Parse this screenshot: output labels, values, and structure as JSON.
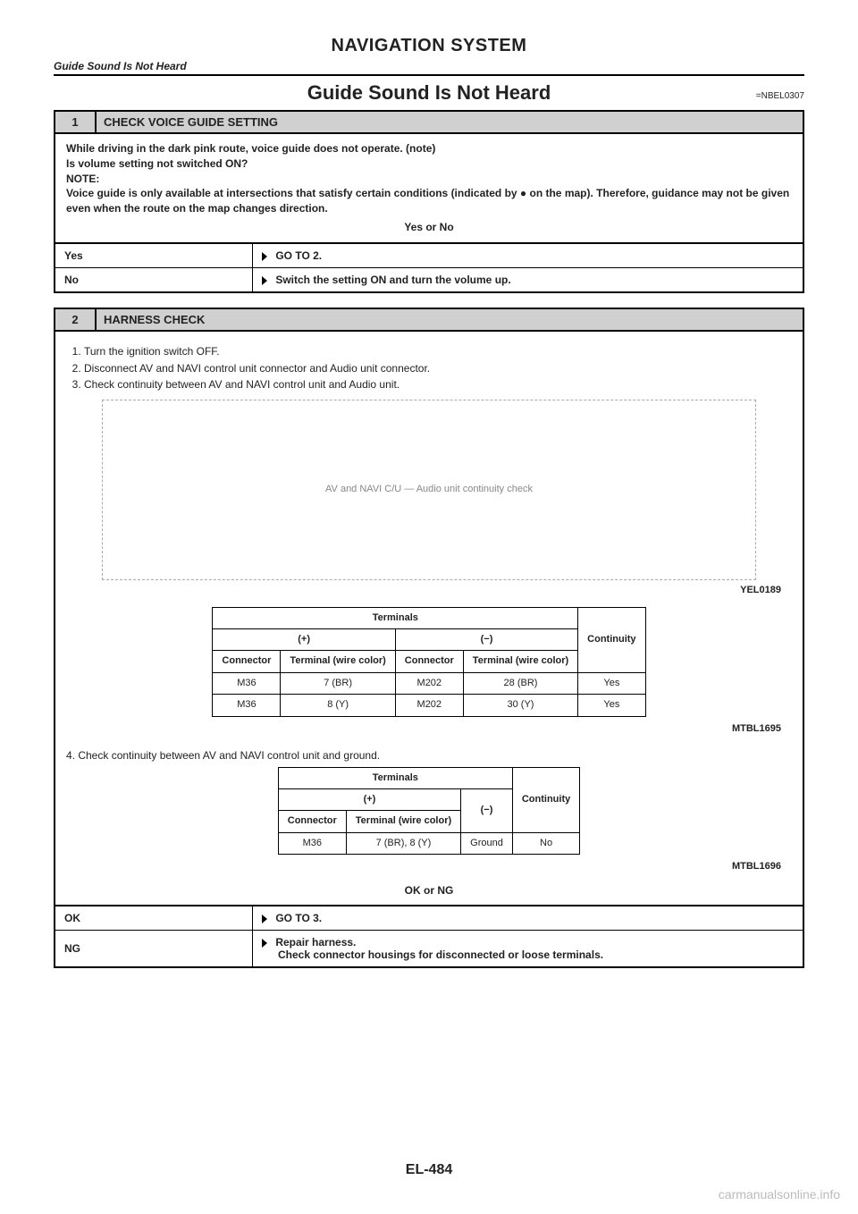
{
  "header": {
    "system_title": "NAVIGATION SYSTEM",
    "breadcrumb": "Guide Sound Is Not Heard",
    "section_title": "Guide Sound Is Not Heard",
    "section_code": "=NBEL0307"
  },
  "step1": {
    "num": "1",
    "label": "CHECK VOICE GUIDE SETTING",
    "body_line1": "While driving in the dark pink route, voice guide does not operate. (note)",
    "body_line2": "Is volume setting not switched ON?",
    "note_label": "NOTE:",
    "note_text": "Voice guide is only available at intersections that satisfy certain conditions (indicated by ● on the map). Therefore, guidance may not be given even when the route on the map changes direction.",
    "result_label": "Yes or No",
    "rows": [
      {
        "left": "Yes",
        "right": "GO TO 2."
      },
      {
        "left": "No",
        "right": "Switch the setting ON and turn the volume up."
      }
    ]
  },
  "step2": {
    "num": "2",
    "label": "HARNESS CHECK",
    "ol": [
      "Turn the ignition switch OFF.",
      "Disconnect AV and NAVI control unit connector and Audio unit connector.",
      "Check continuity between AV and NAVI control unit and Audio unit."
    ],
    "diagram_label": "AV and NAVI C/U — Audio unit continuity check",
    "diagram_code": "YEL0189",
    "table1": {
      "head_terminals": "Terminals",
      "head_plus": "(+)",
      "head_minus": "(−)",
      "head_continuity": "Continuity",
      "sub_connector": "Connector",
      "sub_terminal": "Terminal (wire color)",
      "rows": [
        {
          "c1": "M36",
          "t1": "7 (BR)",
          "c2": "M202",
          "t2": "28 (BR)",
          "cont": "Yes"
        },
        {
          "c1": "M36",
          "t1": "8 (Y)",
          "c2": "M202",
          "t2": "30 (Y)",
          "cont": "Yes"
        }
      ],
      "code": "MTBL1695"
    },
    "ol2_item": "Check continuity between AV and NAVI control unit and ground.",
    "table2": {
      "head_terminals": "Terminals",
      "head_plus": "(+)",
      "head_minus": "(−)",
      "head_continuity": "Continuity",
      "sub_connector": "Connector",
      "sub_terminal": "Terminal (wire color)",
      "rows": [
        {
          "c1": "M36",
          "t1": "7 (BR), 8 (Y)",
          "minus": "Ground",
          "cont": "No"
        }
      ],
      "code": "MTBL1696"
    },
    "result_label": "OK or NG",
    "rows": [
      {
        "left": "OK",
        "right": "GO TO 3."
      },
      {
        "left": "NG",
        "right_a": "Repair harness.",
        "right_b": "Check connector housings for disconnected or loose terminals."
      }
    ]
  },
  "footer": {
    "page_num": "EL-484",
    "watermark": "carmanualsonline.info"
  }
}
